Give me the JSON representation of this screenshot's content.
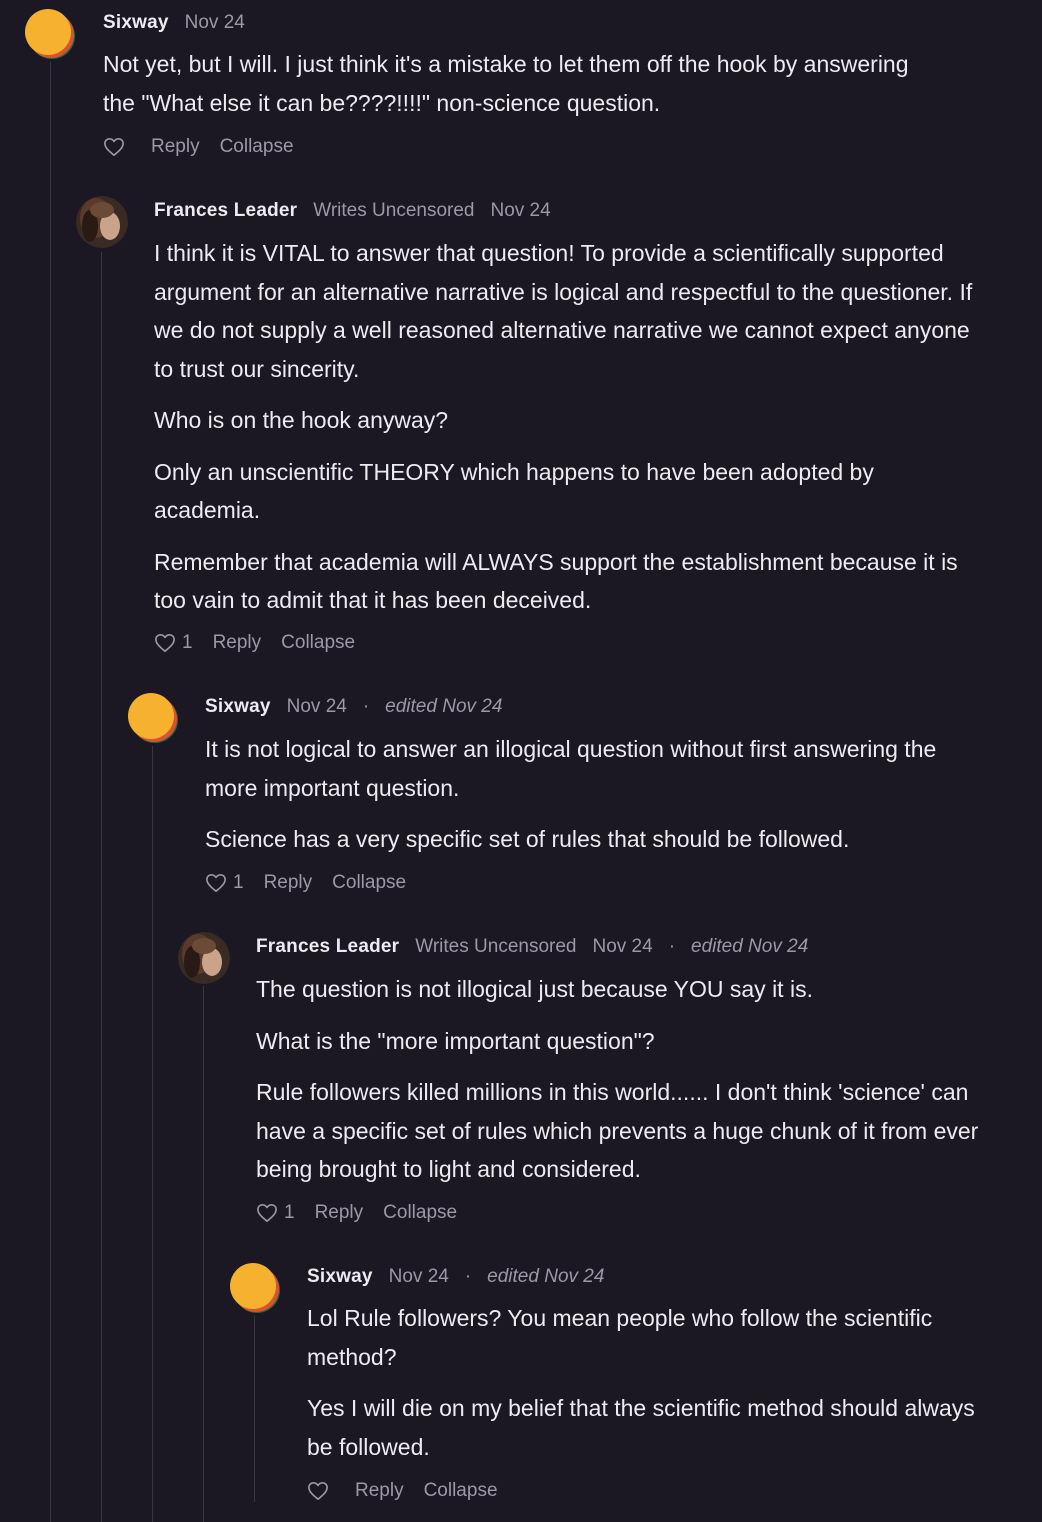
{
  "comments": [
    {
      "author": "Sixway",
      "badge": "",
      "date": "Nov 24",
      "edited": "",
      "paragraphs": [
        "Not yet, but I will. I just think it's a mistake to let them off the hook by answering the \"What else it can be????!!!!\" non-science question."
      ],
      "likes": "",
      "reply_label": "Reply",
      "collapse_label": "Collapse",
      "avatar": "orange-circle-avatar"
    },
    {
      "author": "Frances Leader",
      "badge": "Writes Uncensored",
      "date": "Nov 24",
      "edited": "",
      "paragraphs": [
        "I think it is VITAL to answer that question! To provide a scientifically supported argument for an alternative narrative is logical and respectful to the questioner. If we do not supply a well reasoned alternative narrative we cannot expect anyone to trust our sincerity.",
        "Who is on the hook anyway?",
        "Only an unscientific THEORY which happens to have been adopted by academia.",
        "Remember that academia will ALWAYS support the establishment because it is too vain to admit that it has been deceived."
      ],
      "likes": "1",
      "reply_label": "Reply",
      "collapse_label": "Collapse",
      "avatar": "photo-avatar"
    },
    {
      "author": "Sixway",
      "badge": "",
      "date": "Nov 24",
      "dot": "·",
      "edited": "edited Nov 24",
      "paragraphs": [
        "It is not logical to answer an illogical question without first answering the more important question.",
        "Science has a very specific set of rules that should be followed."
      ],
      "likes": "1",
      "reply_label": "Reply",
      "collapse_label": "Collapse",
      "avatar": "orange-circle-avatar"
    },
    {
      "author": "Frances Leader",
      "badge": "Writes Uncensored",
      "date": "Nov 24",
      "dot": "·",
      "edited": "edited Nov 24",
      "paragraphs": [
        "The question is not illogical just because YOU say it is.",
        "What is the \"more important question\"?",
        "Rule followers killed millions in this world...... I don't think 'science' can have a specific set of rules which prevents a huge chunk of it from ever being brought to light and considered."
      ],
      "likes": "1",
      "reply_label": "Reply",
      "collapse_label": "Collapse",
      "avatar": "photo-avatar"
    },
    {
      "author": "Sixway",
      "badge": "",
      "date": "Nov 24",
      "dot": "·",
      "edited": "edited Nov 24",
      "paragraphs": [
        "Lol Rule followers? You mean people who follow the scientific method?",
        "Yes I will die on my belief that the scientific method should always be followed."
      ],
      "likes": "",
      "reply_label": "Reply",
      "collapse_label": "Collapse",
      "avatar": "orange-circle-avatar"
    }
  ],
  "colors": {
    "background": "#1b1824",
    "text": "#ecebf0",
    "muted": "#9c98a8",
    "thread_line": "#3a3646",
    "avatar_orange": "#f6b12f",
    "avatar_green": "#1f6a4d",
    "avatar_red": "#d9542e"
  }
}
